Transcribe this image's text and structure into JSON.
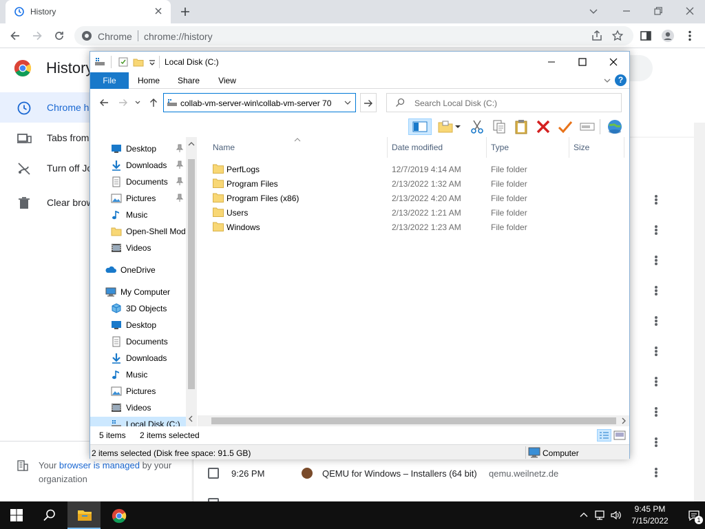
{
  "chrome": {
    "tab_title": "History",
    "omnibox_label": "Chrome",
    "url": "chrome://history",
    "page_title": "History",
    "nav": [
      {
        "label": "Chrome history"
      },
      {
        "label": "Tabs from other devices"
      },
      {
        "label": "Turn off Journeys"
      },
      {
        "label": "Clear browsing data"
      }
    ],
    "managed": {
      "prefix": "Your ",
      "link": "browser is managed",
      "suffix": " by your organization"
    },
    "history_entry": {
      "time": "9:26 PM",
      "title": "QEMU for Windows – Installers (64 bit)",
      "domain": "qemu.weilnetz.de"
    },
    "accent_color": "#1967d2"
  },
  "explorer": {
    "title": "Local Disk (C:)",
    "ribbon_tabs": [
      "File",
      "Home",
      "Share",
      "View"
    ],
    "address": "collab-vm-server-win\\collab-vm-server 70",
    "search_placeholder": "Search Local Disk (C:)",
    "nav_items": [
      {
        "label": "Desktop",
        "icon": "desktop-icon",
        "pinned": true
      },
      {
        "label": "Downloads",
        "icon": "downloads-icon",
        "pinned": true
      },
      {
        "label": "Documents",
        "icon": "documents-icon",
        "pinned": true
      },
      {
        "label": "Pictures",
        "icon": "pictures-icon",
        "pinned": true
      },
      {
        "label": "Music",
        "icon": "music-icon",
        "pinned": false
      },
      {
        "label": "Open-Shell Mod",
        "icon": "folder-icon",
        "pinned": false
      },
      {
        "label": "Videos",
        "icon": "videos-icon",
        "pinned": false
      },
      {
        "label": "OneDrive",
        "icon": "onedrive-icon",
        "pinned": false
      },
      {
        "label": "My Computer",
        "icon": "computer-icon",
        "pinned": false
      },
      {
        "label": "3D Objects",
        "icon": "3d-objects-icon",
        "pinned": false
      },
      {
        "label": "Desktop",
        "icon": "desktop-icon",
        "pinned": false
      },
      {
        "label": "Documents",
        "icon": "documents-icon",
        "pinned": false
      },
      {
        "label": "Downloads",
        "icon": "downloads-icon",
        "pinned": false
      },
      {
        "label": "Music",
        "icon": "music-icon",
        "pinned": false
      },
      {
        "label": "Pictures",
        "icon": "pictures-icon",
        "pinned": false
      },
      {
        "label": "Videos",
        "icon": "videos-icon",
        "pinned": false
      },
      {
        "label": "Local Disk (C:)",
        "icon": "drive-icon",
        "pinned": false,
        "selected": true
      }
    ],
    "columns": [
      "Name",
      "Date modified",
      "Type",
      "Size"
    ],
    "files": [
      {
        "name": "PerfLogs",
        "date": "12/7/2019 4:14 AM",
        "type": "File folder"
      },
      {
        "name": "Program Files",
        "date": "2/13/2022 1:32 AM",
        "type": "File folder"
      },
      {
        "name": "Program Files (x86)",
        "date": "2/13/2022 4:20 AM",
        "type": "File folder"
      },
      {
        "name": "Users",
        "date": "2/13/2022 1:21 AM",
        "type": "File folder"
      },
      {
        "name": "Windows",
        "date": "2/13/2022 1:23 AM",
        "type": "File folder"
      }
    ],
    "status_count": "5 items",
    "status_selected": "2 items selected",
    "details_text": "2 items selected (Disk free space: 91.5 GB)",
    "details_location": "Computer",
    "accent_color": "#1979ca"
  },
  "taskbar": {
    "time": "9:45 PM",
    "date": "7/15/2022",
    "notification_count": "1"
  }
}
